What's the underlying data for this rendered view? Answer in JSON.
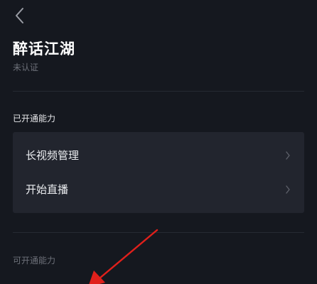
{
  "header": {
    "back_icon": "chevron-left-icon"
  },
  "profile": {
    "name": "醉话江湖",
    "status": "未认证"
  },
  "enabled_section": {
    "title": "已开通能力",
    "items": [
      {
        "label": "长视频管理",
        "icon": "chevron-right-icon"
      },
      {
        "label": "开始直播",
        "icon": "chevron-right-icon"
      }
    ]
  },
  "available_section": {
    "title": "可开通能力"
  },
  "colors": {
    "background": "#15181f",
    "card": "#22252e",
    "muted_text": "#6d7079",
    "annotation_arrow": "#e0201b"
  }
}
